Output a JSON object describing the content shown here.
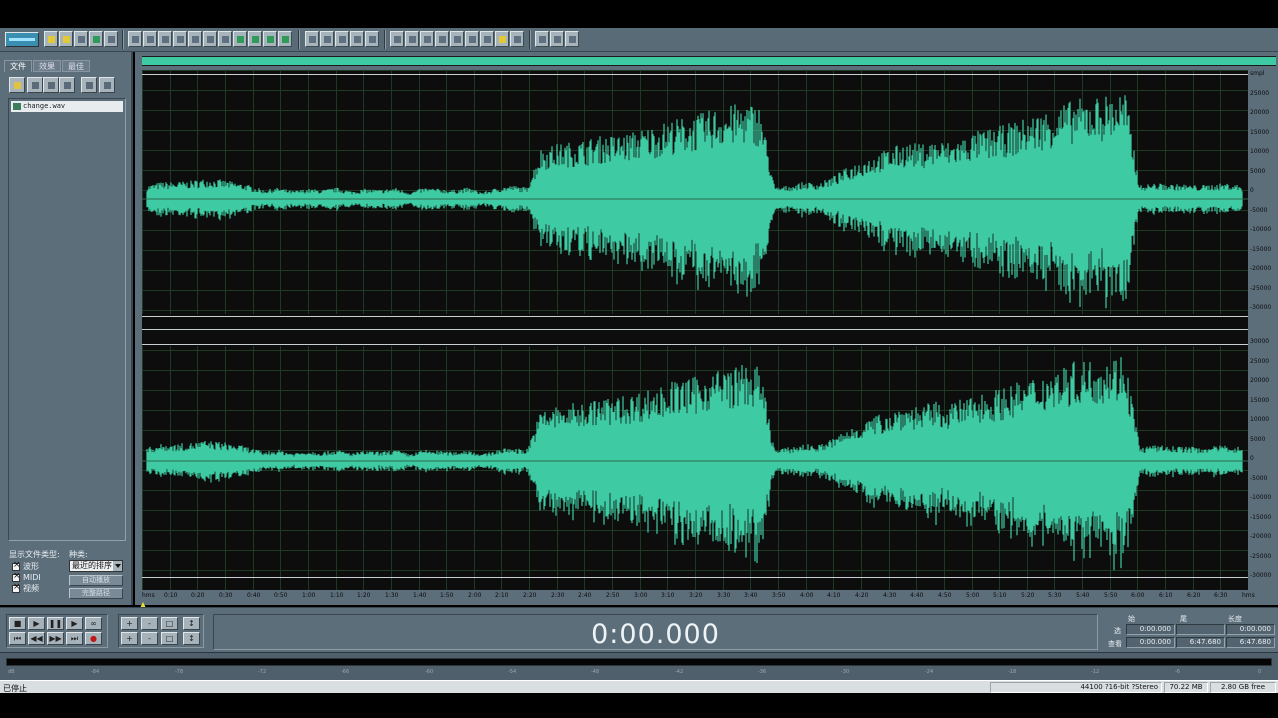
{
  "left_panel": {
    "tabs": [
      "文件",
      "效果",
      "最佳"
    ],
    "files": [
      "change.wav"
    ],
    "show_types_label": "显示文件类型:",
    "sort_label": "种类:",
    "types": [
      "波形",
      "MIDI",
      "视频"
    ],
    "sort_value": "最近的排序",
    "buttons": [
      "自动播放",
      "完整路径"
    ]
  },
  "waveform": {
    "scale_unit": "smpl",
    "top_scale": [
      "smpl",
      "25000",
      "20000",
      "15000",
      "10000",
      "5000",
      "0",
      "-5000",
      "-10000",
      "-15000",
      "-20000",
      "-25000",
      "-30000"
    ],
    "bottom_scale": [
      "30000",
      "25000",
      "20000",
      "15000",
      "10000",
      "5000",
      "0",
      "-5000",
      "-10000",
      "-15000",
      "-20000",
      "-25000",
      "-30000"
    ],
    "time_ticks": [
      "hms",
      "0:10",
      "0:20",
      "0:30",
      "0:40",
      "0:50",
      "1:00",
      "1:10",
      "1:20",
      "1:30",
      "1:40",
      "1:50",
      "2:00",
      "2:10",
      "2:20",
      "2:30",
      "2:40",
      "2:50",
      "3:00",
      "3:10",
      "3:20",
      "3:30",
      "3:40",
      "3:50",
      "4:00",
      "4:10",
      "4:20",
      "4:30",
      "4:40",
      "4:50",
      "5:00",
      "5:10",
      "5:20",
      "5:30",
      "5:40",
      "5:50",
      "6:00",
      "6:10",
      "6:20",
      "6:30",
      "hms"
    ],
    "color": "#3ecba3",
    "envelope": [
      0.12,
      0.15,
      0.15,
      0.16,
      0.18,
      0.17,
      0.15,
      0.12,
      0.08,
      0.1,
      0.07,
      0.09,
      0.08,
      0.1,
      0.07,
      0.09,
      0.08,
      0.1,
      0.06,
      0.1,
      0.09,
      0.08,
      0.1,
      0.06,
      0.1,
      0.12,
      0.1,
      0.45,
      0.48,
      0.5,
      0.52,
      0.55,
      0.56,
      0.58,
      0.62,
      0.65,
      0.7,
      0.72,
      0.75,
      0.8,
      0.82,
      0.85,
      0.82,
      0.1,
      0.12,
      0.15,
      0.14,
      0.2,
      0.28,
      0.35,
      0.4,
      0.45,
      0.5,
      0.48,
      0.52,
      0.5,
      0.55,
      0.6,
      0.62,
      0.66,
      0.7,
      0.75,
      0.8,
      0.85,
      0.88,
      0.9,
      0.92,
      0.95,
      0.12,
      0.14,
      0.13,
      0.13,
      0.12,
      0.13,
      0.14,
      0.12
    ]
  },
  "transport": {
    "buttons_row1": [
      "■",
      "▶",
      "❚❚",
      "▶",
      "∞"
    ],
    "buttons_row2": [
      "⏮",
      "◀◀",
      "▶▶",
      "⏭",
      "●"
    ],
    "zoom_row1": [
      "+",
      "-",
      "□",
      "↕"
    ],
    "zoom_row2": [
      "+",
      "-",
      "□",
      "↕"
    ],
    "time": "0:00.000"
  },
  "selection": {
    "headers": [
      "始",
      "尾",
      "长度"
    ],
    "rows": [
      {
        "label": "选",
        "values": [
          "0:00.000",
          "",
          "0:00.000"
        ]
      },
      {
        "label": "查看",
        "values": [
          "0:00.000",
          "6:47.680",
          "6:47.680"
        ]
      }
    ]
  },
  "level_labels": [
    "dB",
    "-84",
    "-78",
    "-72",
    "-66",
    "-60",
    "-54",
    "-48",
    "-42",
    "-36",
    "-30",
    "-24",
    "-18",
    "-12",
    "-6",
    "0"
  ],
  "status": {
    "state": "已停止",
    "format": "44100 ?16-bit ?Stereo",
    "size": "70.22 MB",
    "free": "2.80 GB free"
  }
}
